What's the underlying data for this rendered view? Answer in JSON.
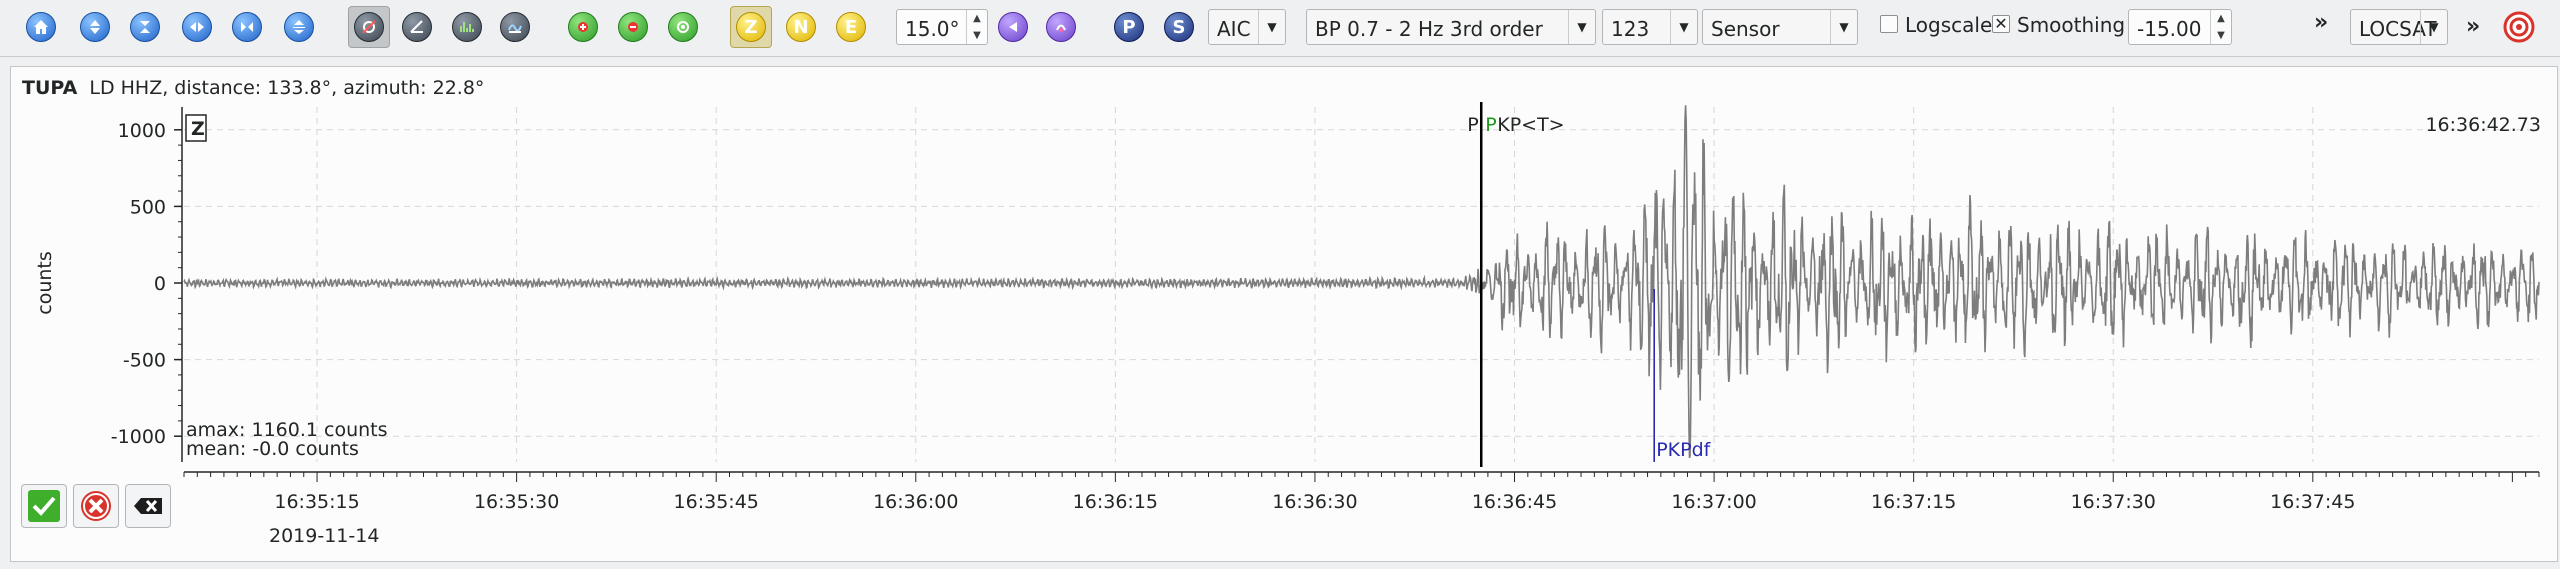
{
  "toolbar": {
    "icons_group1": [
      "home-icon",
      "scroll-up-icon",
      "zoom-vertical-icon",
      "scroll-left-icon",
      "scroll-right-icon",
      "expand-icon"
    ],
    "icons_group2": [
      "rotate-icon",
      "compass-icon",
      "spectrum-icon",
      "filter-icon"
    ],
    "icons_group3": [
      "add-pick-icon",
      "remove-pick-icon",
      "reset-pick-icon"
    ],
    "components": [
      "Z",
      "N",
      "E"
    ],
    "angle_value": "15.0°",
    "pick_p": "P",
    "pick_s": "S",
    "picker": "AIC",
    "filter": "BP 0.7 - 2 Hz  3rd order",
    "stream": "123",
    "unit": "Sensor",
    "logscale_label": "Logscale",
    "logscale_checked": false,
    "smoothing_label": "Smoothing",
    "smoothing_checked": true,
    "smoothing_value": "-15.00",
    "overflow_icon": "»",
    "locator": "LOCSAT",
    "overflow_icon2": "»"
  },
  "trace": {
    "station": "TUPA",
    "network_channel": "LD  HHZ, distance: 133.8°, azimuth: 22.8°",
    "component_tag": "Z",
    "time_readout": "16:36:42.73",
    "ylabel": "counts",
    "amax": "amax: 1160.1 counts",
    "mean": "mean: -0.0 counts",
    "date": "2019-11-14",
    "pick_labels": {
      "p": "P",
      "pkp": "PKP",
      "t": "<T>",
      "pkpdf": "PKPdf"
    }
  },
  "chart_data": {
    "type": "line",
    "ylabel": "counts",
    "ylim": [
      -1160,
      1160
    ],
    "yticks": [
      1000,
      500,
      0,
      -500,
      -1000
    ],
    "xticks": [
      "16:35:15",
      "16:35:30",
      "16:35:45",
      "16:36:00",
      "16:36:15",
      "16:36:30",
      "16:36:45",
      "16:37:00",
      "16:37:15",
      "16:37:30",
      "16:37:45"
    ],
    "x_start_seconds": 0,
    "x_end_seconds": 177,
    "tick_start_offset_s": 10,
    "tick_step_s": 15,
    "onset_seconds": 97.5,
    "pkpdf_seconds": 110.5,
    "pick_seconds": 97.5,
    "envelope": [
      [
        0,
        25
      ],
      [
        96,
        30
      ],
      [
        97.5,
        120
      ],
      [
        100,
        330
      ],
      [
        108,
        350
      ],
      [
        111,
        700
      ],
      [
        113,
        1160
      ],
      [
        115,
        720
      ],
      [
        118,
        560
      ],
      [
        125,
        420
      ],
      [
        135,
        420
      ],
      [
        150,
        330
      ],
      [
        165,
        280
      ],
      [
        177,
        240
      ]
    ]
  },
  "buttons": {
    "accept": "accept-icon",
    "reject": "reject-icon",
    "clear": "clear-icon"
  }
}
